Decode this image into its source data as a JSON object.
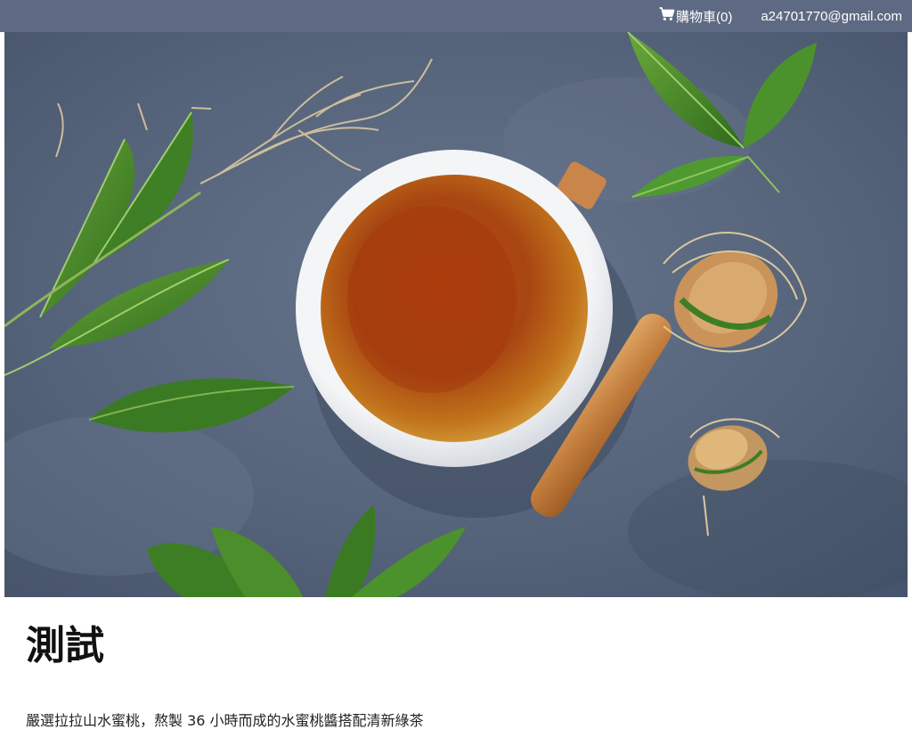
{
  "header": {
    "cart_label": "購物車(0)",
    "cart_icon": "shopping-cart-icon",
    "user_email": "a24701770@gmail.com",
    "background_color": "#5e6a83"
  },
  "hero": {
    "image_description_icon": "tea-cup-image"
  },
  "product": {
    "title": "測試",
    "description": "嚴選拉拉山水蜜桃，熬製 36 小時而成的水蜜桃醬搭配清新綠茶"
  }
}
